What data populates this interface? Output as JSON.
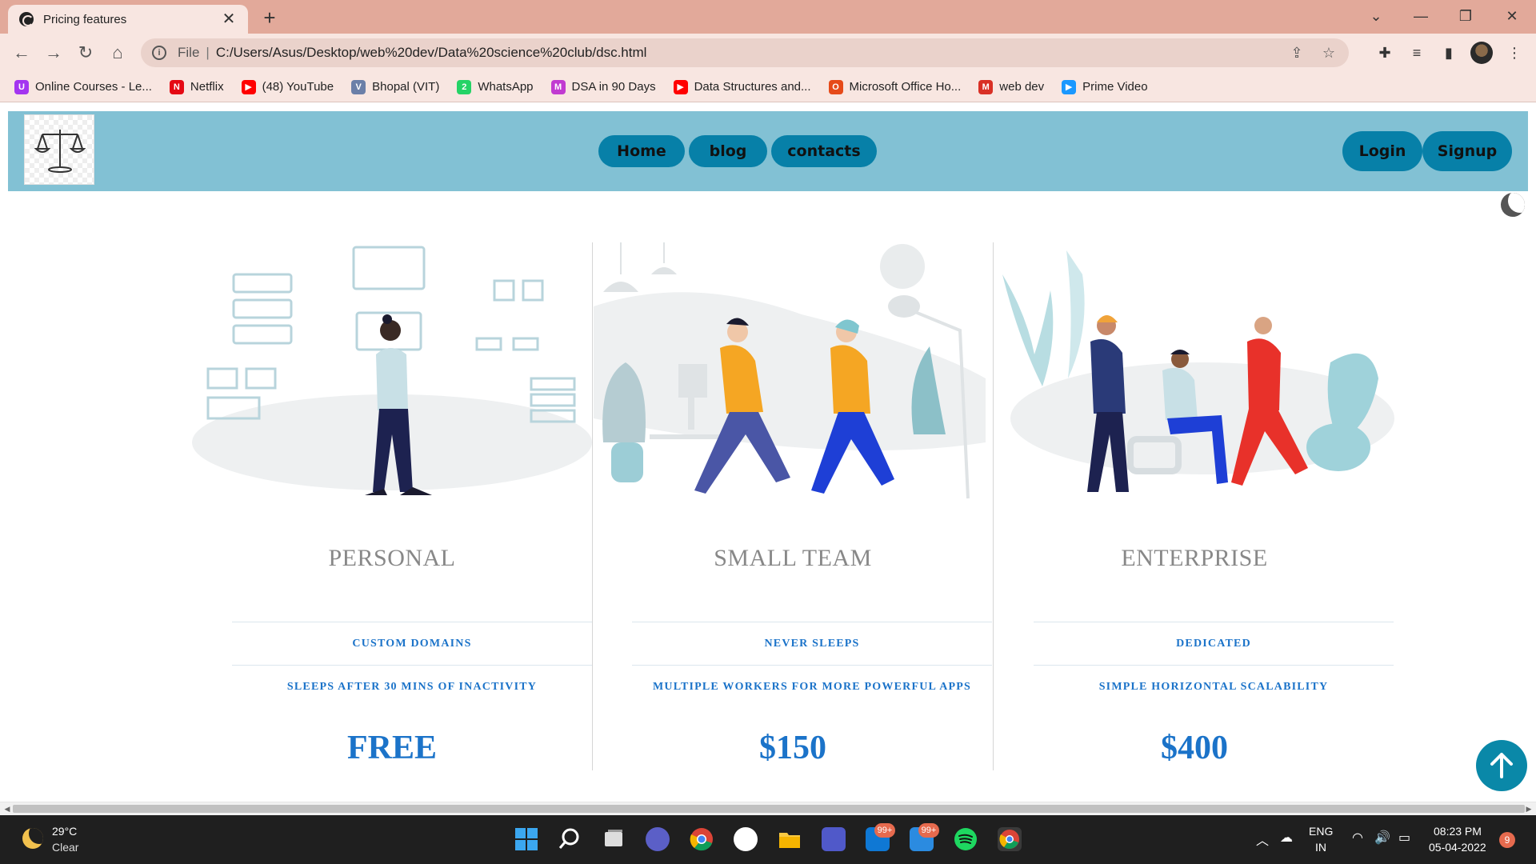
{
  "browser": {
    "tab_title": "Pricing features",
    "new_tab_label": "+",
    "tab_close": "✕",
    "url_scheme": "File",
    "url": "C:/Users/Asus/Desktop/web%20dev/Data%20science%20club/dsc.html",
    "window_controls": {
      "dropdown": "⌄",
      "minimize": "—",
      "restore": "❐",
      "close": "✕"
    },
    "bookmarks": [
      {
        "label": "Online Courses - Le...",
        "icon": "online-courses-icon",
        "color": "#a435f0",
        "glyph": "U"
      },
      {
        "label": "Netflix",
        "icon": "netflix-icon",
        "color": "#e50914",
        "glyph": "N"
      },
      {
        "label": "(48) YouTube",
        "icon": "youtube-icon",
        "color": "#ff0000",
        "glyph": "▶"
      },
      {
        "label": "Bhopal (VIT)",
        "icon": "vit-icon",
        "color": "#6b7fa8",
        "glyph": "V"
      },
      {
        "label": "WhatsApp",
        "icon": "whatsapp-icon",
        "color": "#25d366",
        "glyph": "2"
      },
      {
        "label": "DSA in 90 Days",
        "icon": "dsa-icon",
        "color": "#c13bd1",
        "glyph": "M"
      },
      {
        "label": "Data Structures and...",
        "icon": "youtube-icon",
        "color": "#ff0000",
        "glyph": "▶"
      },
      {
        "label": "Microsoft Office Ho...",
        "icon": "office-icon",
        "color": "#e64a19",
        "glyph": "O"
      },
      {
        "label": "web dev",
        "icon": "gmail-icon",
        "color": "#d93025",
        "glyph": "M"
      },
      {
        "label": "Prime Video",
        "icon": "prime-video-icon",
        "color": "#1a98ff",
        "glyph": "▶"
      }
    ]
  },
  "site": {
    "nav": {
      "home": "Home",
      "blog": "blog",
      "contacts": "contacts"
    },
    "auth": {
      "login": "Login",
      "signup": "Signup"
    },
    "plans": [
      {
        "title": "PERSONAL",
        "features": [
          "CUSTOM DOMAINS",
          "SLEEPS AFTER 30 MINS OF INACTIVITY"
        ],
        "price": "FREE"
      },
      {
        "title": "SMALL TEAM",
        "features": [
          "NEVER SLEEPS",
          "MULTIPLE WORKERS FOR MORE POWERFUL APPS"
        ],
        "price": "$150"
      },
      {
        "title": "ENTERPRISE",
        "features": [
          "DEDICATED",
          "SIMPLE HORIZONTAL SCALABILITY"
        ],
        "price": "$400"
      }
    ],
    "colors": {
      "header_bg": "#82c1d4",
      "pill_bg": "#0780a8",
      "accent_text": "#1b73c9"
    }
  },
  "taskbar": {
    "weather_temp": "29°C",
    "weather_desc": "Clear",
    "lang_top": "ENG",
    "lang_bottom": "IN",
    "time": "08:23 PM",
    "date": "05-04-2022",
    "notifications": "9",
    "badge_outlook": "99+",
    "badge_mail": "99+"
  }
}
